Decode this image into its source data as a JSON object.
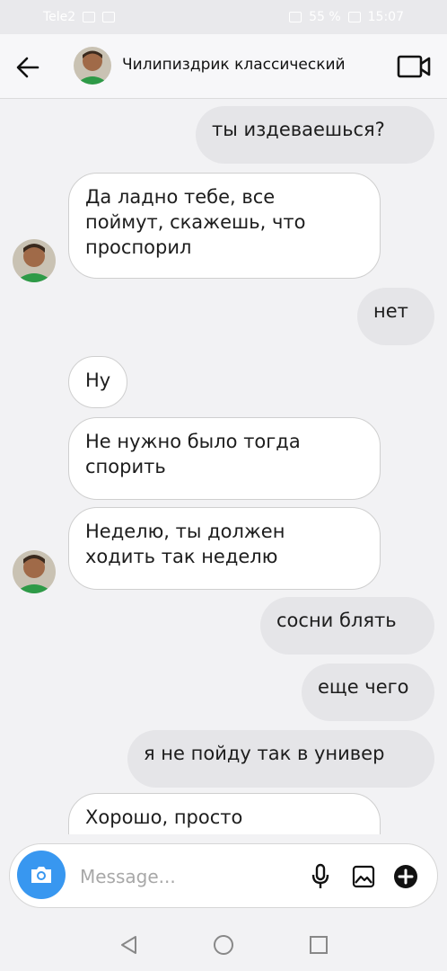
{
  "status_bar": {
    "carrier": "Tele2",
    "battery": "55 %",
    "time": "15:07"
  },
  "header": {
    "contact_name": "Чилипиздрик классический",
    "back_icon": "arrow-left-icon",
    "video_icon": "video-camera-icon"
  },
  "messages": [
    {
      "side": "out",
      "text": "ты издеваешься?"
    },
    {
      "side": "in",
      "text": "Да ладно тебе, все\nпоймут, скажешь, что\nпроспорил"
    },
    {
      "side": "out",
      "text": "нет"
    },
    {
      "side": "in",
      "text": "Ну"
    },
    {
      "side": "in",
      "text": "Не нужно было тогда\nспорить"
    },
    {
      "side": "in",
      "text": "Неделю, ты должен\nходить так неделю"
    },
    {
      "side": "out",
      "text": "сосни блять"
    },
    {
      "side": "out",
      "text": "еще чего"
    },
    {
      "side": "out",
      "text": "я не пойду так в универ"
    },
    {
      "side": "in",
      "text": "Хорошо, просто"
    }
  ],
  "composer": {
    "placeholder": "Message...",
    "camera_icon": "camera-icon",
    "mic_icon": "microphone-icon",
    "gallery_icon": "image-icon",
    "plus_icon": "plus-circle-icon"
  },
  "nav": {
    "back_icon": "triangle-back-icon",
    "home_icon": "circle-home-icon",
    "recents_icon": "square-recents-icon"
  },
  "colors": {
    "accent": "#3897f0",
    "outgoing_bubble": "#e5e5e8",
    "incoming_bubble": "#ffffff"
  }
}
